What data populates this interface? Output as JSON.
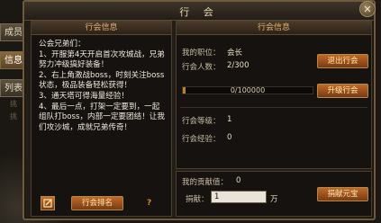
{
  "window": {
    "title": "行 会",
    "close": "✕"
  },
  "side_tabs": [
    "成员",
    "信息",
    "列表"
  ],
  "side_faint": [
    "挑",
    "挑"
  ],
  "left_panel": {
    "header": "行会信息",
    "notice": "公会兄弟们：\n1、开服第4天开启首次攻城战，兄弟努力冲级搞好装备！\n2、右上角激战boss，时刻关注boss状态，极品装备轻松获得！\n3、通天塔可得海量经验！\n4、最后一点，打架一定要到，一起组队打boss，内部一定要团结！让我们攻沙城，成就兄弟传奇！",
    "rank_button": "行会排名",
    "edit_icon": "edit-icon",
    "help": "?"
  },
  "right_panel": {
    "header": "行会信息",
    "my_position_label": "我的职位：",
    "my_position_value": "会长",
    "members_label": "行会人数：",
    "members_value": "2/300",
    "leave_button": "退出行会",
    "progress_text": "0/100000",
    "progress_fraction": 0,
    "upgrade_button": "升级行会",
    "level_label": "行会等级：",
    "level_value": "1",
    "exp_label": "行会经验：",
    "exp_value": "0",
    "contribution_label": "我的贡献值：",
    "contribution_value": "0",
    "donate_label": "捐献：",
    "donate_value": "1",
    "donate_unit": "万",
    "donate_button": "捐献元宝"
  },
  "colors": {
    "accent": "#c06a28",
    "header_text": "#e8b070"
  }
}
